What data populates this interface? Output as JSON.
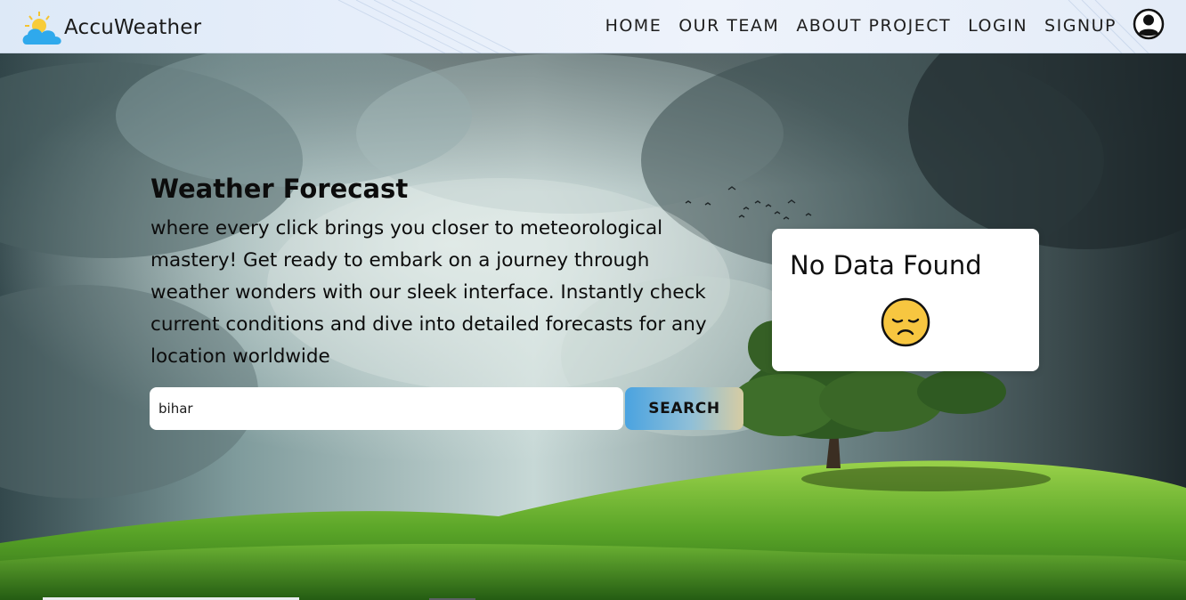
{
  "brand": {
    "name": "AccuWeather",
    "logo_icon": "sun-cloud-icon"
  },
  "nav": {
    "items": [
      {
        "label": "HOME"
      },
      {
        "label": "OUR TEAM"
      },
      {
        "label": "ABOUT PROJECT"
      },
      {
        "label": "LOGIN"
      },
      {
        "label": "SIGNUP"
      }
    ],
    "user_icon": "user-circle-icon"
  },
  "hero": {
    "title": "Weather Forecast",
    "description": "where every click brings you closer to meteorological mastery! Get ready to embark on a journey through weather wonders with our sleek interface. Instantly check current conditions and dive into detailed forecasts for any location worldwide"
  },
  "search": {
    "value": "bihar",
    "button_label": "SEARCH"
  },
  "result": {
    "message": "No Data Found",
    "icon": "sad-face-icon"
  },
  "colors": {
    "navbar_bg": "#e6eefa",
    "button_gradient_start": "#4aa3e0",
    "button_gradient_end": "#d6cca3",
    "card_bg": "#ffffff",
    "grass": "#5fa82c",
    "sky": "#7d9a9c"
  }
}
